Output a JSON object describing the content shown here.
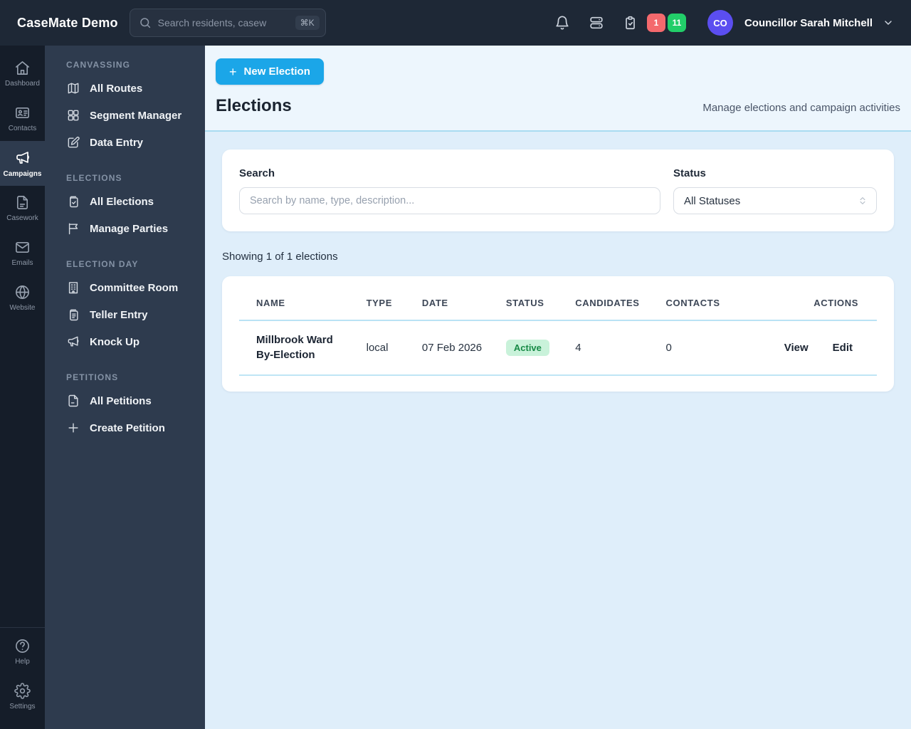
{
  "topbar": {
    "brand": "CaseMate Demo",
    "search": {
      "placeholder": "Search residents, casew",
      "shortcut": "⌘K"
    },
    "badges": {
      "red": "1",
      "green": "11"
    },
    "user": {
      "initials": "CO",
      "name": "Councillor Sarah Mitchell"
    }
  },
  "rail": {
    "items": [
      {
        "label": "Dashboard"
      },
      {
        "label": "Contacts"
      },
      {
        "label": "Campaigns",
        "active": true
      },
      {
        "label": "Casework"
      },
      {
        "label": "Emails"
      },
      {
        "label": "Website"
      }
    ],
    "bottom": [
      {
        "label": "Help"
      },
      {
        "label": "Settings"
      }
    ]
  },
  "sidebar": {
    "sections": [
      {
        "heading": "CANVASSING",
        "items": [
          {
            "label": "All Routes"
          },
          {
            "label": "Segment Manager"
          },
          {
            "label": "Data Entry"
          }
        ]
      },
      {
        "heading": "ELECTIONS",
        "items": [
          {
            "label": "All Elections"
          },
          {
            "label": "Manage Parties"
          }
        ]
      },
      {
        "heading": "ELECTION DAY",
        "items": [
          {
            "label": "Committee Room"
          },
          {
            "label": "Teller Entry"
          },
          {
            "label": "Knock Up"
          }
        ]
      },
      {
        "heading": "PETITIONS",
        "items": [
          {
            "label": "All Petitions"
          },
          {
            "label": "Create Petition"
          }
        ]
      }
    ]
  },
  "main": {
    "new_election_label": "New Election",
    "title": "Elections",
    "subtitle": "Manage elections and campaign activities",
    "filters": {
      "search_label": "Search",
      "search_placeholder": "Search by name, type, description...",
      "status_label": "Status",
      "status_value": "All Statuses"
    },
    "results_summary": "Showing 1 of 1 elections",
    "table": {
      "headers": [
        "NAME",
        "TYPE",
        "DATE",
        "STATUS",
        "CANDIDATES",
        "CONTACTS",
        "ACTIONS"
      ],
      "rows": [
        {
          "name": "Millbrook Ward By-Election",
          "type": "local",
          "date": "07 Feb 2026",
          "status": "Active",
          "candidates": "4",
          "contacts": "0",
          "actions": [
            "View",
            "Edit"
          ]
        }
      ]
    }
  },
  "colors": {
    "accent_blue": "#1ba6e8",
    "badge_red": "#f4696d",
    "badge_green": "#22ce69",
    "avatar_purple": "#5b4ef0",
    "status_active_bg": "#c9f2da",
    "status_active_text": "#178a46",
    "topbar_bg": "#1e2836",
    "rail_bg": "#151d29",
    "sidebar_bg": "#2e3b4e",
    "content_bg": "#dfeefa"
  }
}
